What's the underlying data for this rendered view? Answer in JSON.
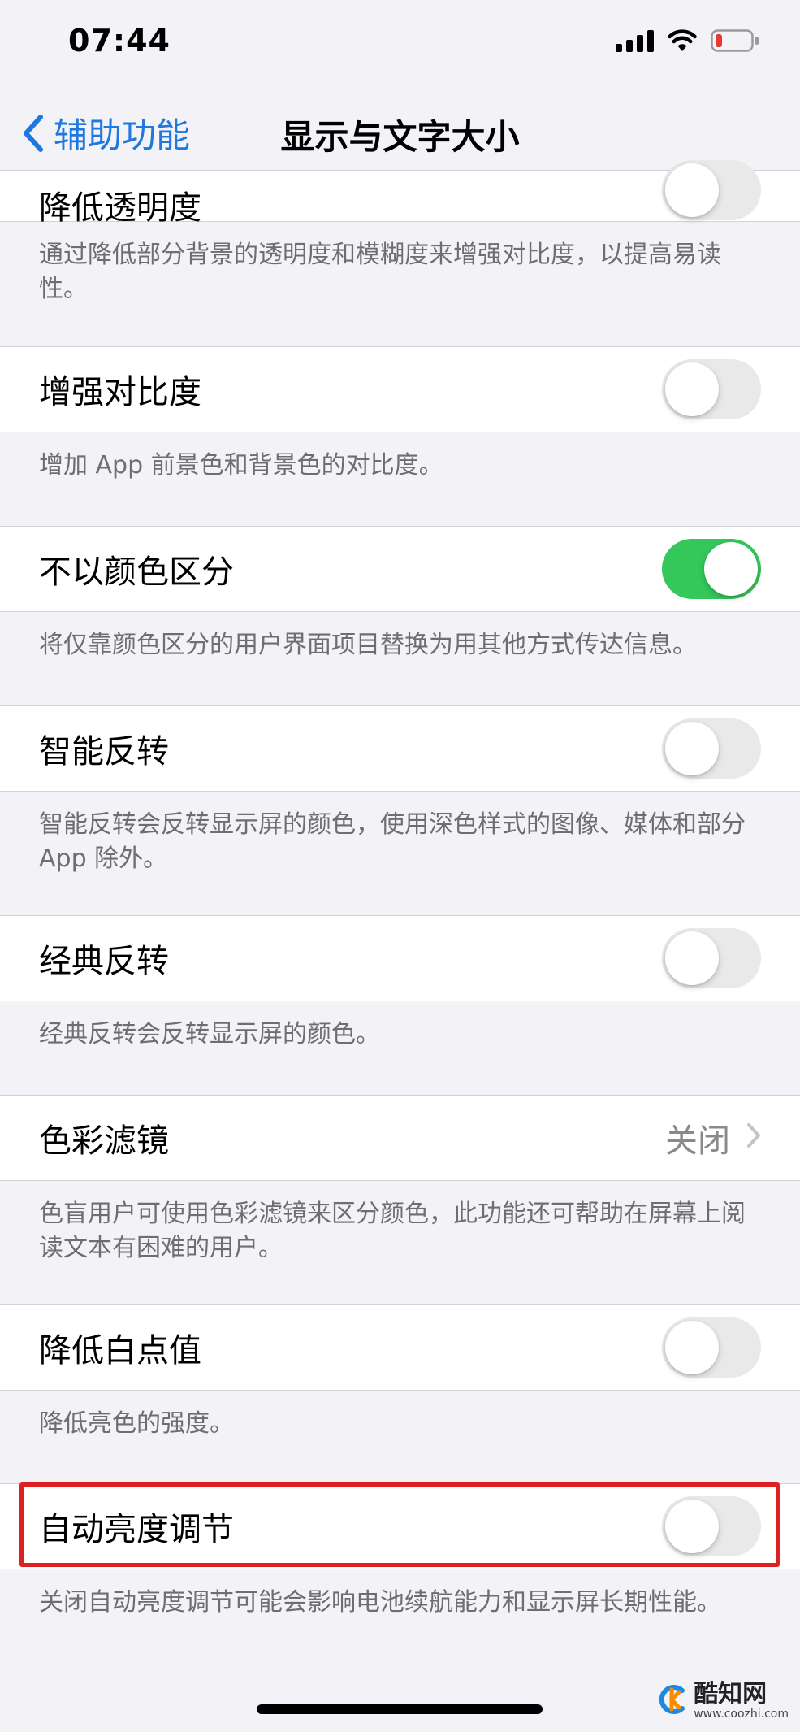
{
  "status_bar": {
    "time": "07:44",
    "icons": [
      "cellular-signal-icon",
      "wifi-icon",
      "battery-low-icon"
    ],
    "battery_color": "#e53935"
  },
  "nav": {
    "back_label": "辅助功能",
    "title": "显示与文字大小",
    "accent_color": "#1f77e0"
  },
  "settings": [
    {
      "label": "降低透明度",
      "control": "toggle",
      "on": false,
      "footer": "通过降低部分背景的透明度和模糊度来增强对比度，以提高易读性。"
    },
    {
      "label": "增强对比度",
      "control": "toggle",
      "on": false,
      "footer": "增加 App 前景色和背景色的对比度。"
    },
    {
      "label": "不以颜色区分",
      "control": "toggle",
      "on": true,
      "footer": "将仅靠颜色区分的用户界面项目替换为用其他方式传达信息。"
    },
    {
      "label": "智能反转",
      "control": "toggle",
      "on": false,
      "footer": "智能反转会反转显示屏的颜色，使用深色样式的图像、媒体和部分 App 除外。"
    },
    {
      "label": "经典反转",
      "control": "toggle",
      "on": false,
      "footer": "经典反转会反转显示屏的颜色。"
    },
    {
      "label": "色彩滤镜",
      "control": "disclosure",
      "value": "关闭",
      "footer": "色盲用户可使用色彩滤镜来区分颜色，此功能还可帮助在屏幕上阅读文本有困难的用户。"
    },
    {
      "label": "降低白点值",
      "control": "toggle",
      "on": false,
      "footer": "降低亮色的强度。"
    },
    {
      "label": "自动亮度调节",
      "control": "toggle",
      "on": false,
      "highlighted": true,
      "footer": "关闭自动亮度调节可能会影响电池续航能力和显示屏长期性能。"
    }
  ],
  "colors": {
    "toggle_on": "#34c759",
    "toggle_off": "#e9e9ea",
    "highlight": "#e02020"
  },
  "watermark": {
    "title": "酷知网",
    "url": "www.coozhi.com"
  }
}
